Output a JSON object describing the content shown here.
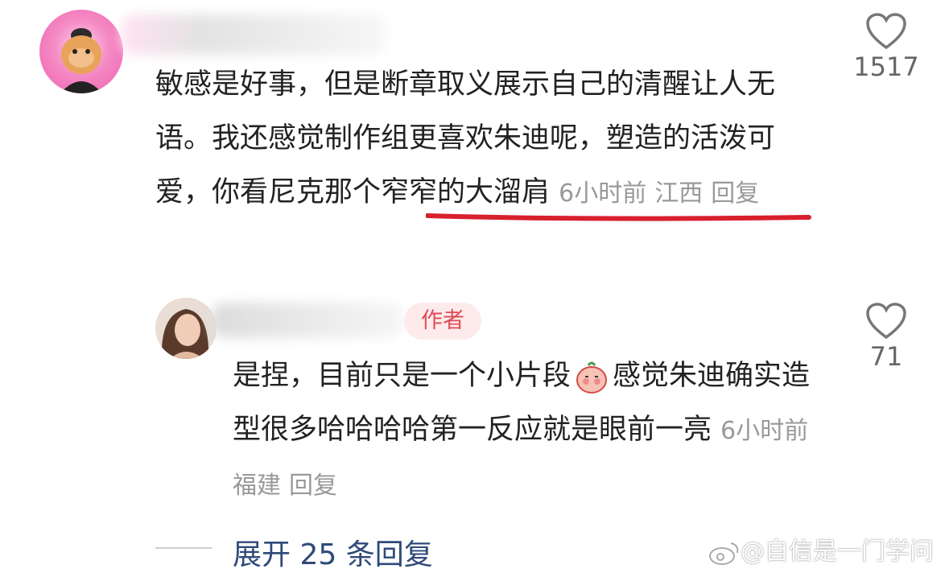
{
  "comments": [
    {
      "text_before_highlight": "敏感是好事，但是断章取义展示自己的清醒让人无语。我还感觉制作组更喜欢朱迪呢，塑造的活泼可爱，",
      "highlight": "你看尼克那个窄窄的大溜肩",
      "time": "6小时前",
      "location": "江西",
      "reply_label": "回复",
      "likes": "1517"
    }
  ],
  "reply": {
    "author_badge": "作者",
    "text_before_emoji": "是捏，目前只是一个小片段",
    "text_after_emoji": "感觉朱迪确实造型很多哈哈哈哈第一反应就是眼前一亮",
    "time": "6小时前",
    "location": "福建",
    "reply_label": "回复",
    "likes": "71"
  },
  "expand_label": "展开 25 条回复",
  "watermark": "@自信是一门学问",
  "colors": {
    "underline": "#d8202e",
    "badge_bg": "#fdebec",
    "badge_text": "#e04b55",
    "expand_text": "#2f4a78"
  },
  "icons": {
    "like": "heart-outline-icon",
    "emoji": "peach-emoji-icon",
    "watermark_logo": "weibo-icon"
  }
}
